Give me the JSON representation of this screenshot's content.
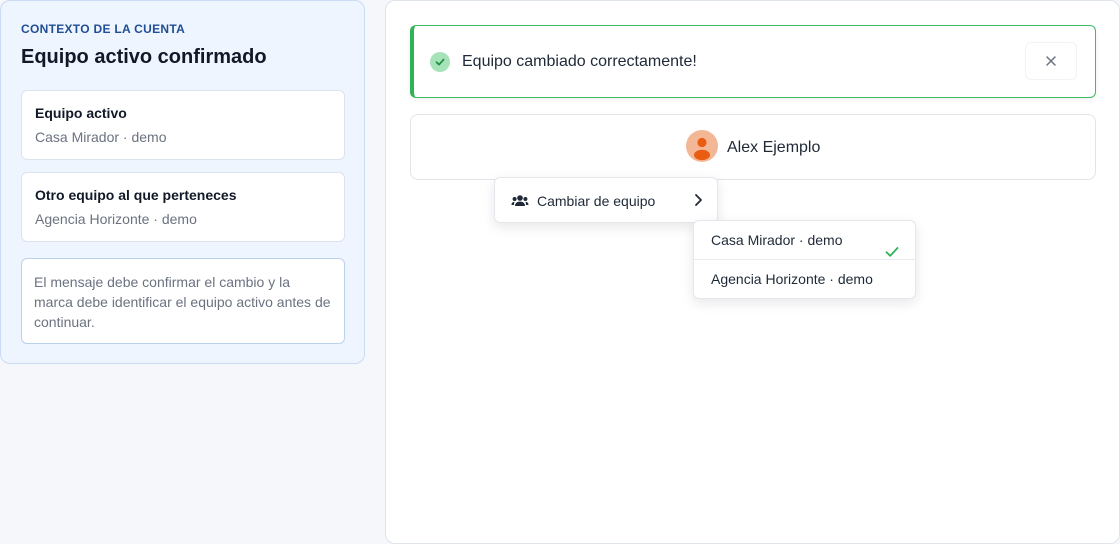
{
  "context": {
    "eyebrow": "CONTEXTO DE LA CUENTA",
    "title": "Equipo activo confirmado",
    "active_card": {
      "title": "Equipo activo",
      "value": "Casa Mirador · demo"
    },
    "other_card": {
      "title": "Otro equipo al que perteneces",
      "value": "Agencia Horizonte · demo"
    },
    "note": "El mensaje debe confirmar el cambio y la marca debe identificar el equipo activo antes de continuar."
  },
  "toast": {
    "message": "Equipo cambiado correctamente!",
    "icon": "check-circle-icon",
    "close_icon": "close-icon",
    "accent_color": "#2fb355"
  },
  "user": {
    "name": "Alex Ejemplo",
    "avatar_icon": "user-avatar-icon",
    "avatar_color": "#f4b796"
  },
  "menu": {
    "label": "Cambiar de equipo",
    "icon": "users-icon",
    "chevron": "chevron-right-icon"
  },
  "submenu": {
    "items": [
      {
        "label": "Casa Mirador · demo",
        "selected": true
      },
      {
        "label": "Agencia Horizonte · demo",
        "selected": false
      }
    ]
  }
}
